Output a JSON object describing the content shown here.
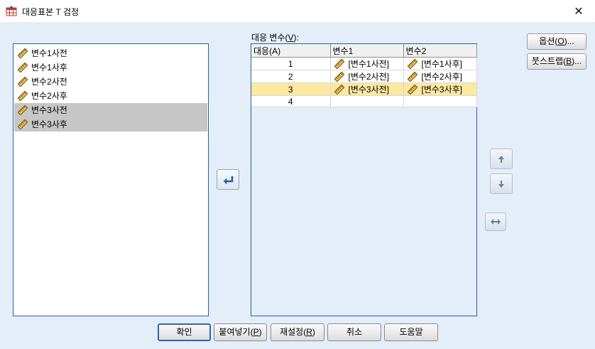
{
  "window": {
    "title": "대응표본 T 검정",
    "close_glyph": "✕"
  },
  "source_list": {
    "items": [
      {
        "label": "변수1사전",
        "selected": false
      },
      {
        "label": "변수1사후",
        "selected": false
      },
      {
        "label": "변수2사전",
        "selected": false
      },
      {
        "label": "변수2사후",
        "selected": false
      },
      {
        "label": "변수3사전",
        "selected": true
      },
      {
        "label": "변수3사후",
        "selected": true
      }
    ]
  },
  "pairs": {
    "label": "대응 변수",
    "mnemonic": "V",
    "headers": [
      "대응(A)",
      "변수1",
      "변수2"
    ],
    "rows": [
      {
        "pair": "1",
        "var1": "[변수1사전]",
        "var2": "[변수1사후]",
        "highlight": false
      },
      {
        "pair": "2",
        "var1": "[변수2사전]",
        "var2": "[변수2사후]",
        "highlight": false
      },
      {
        "pair": "3",
        "var1": "[변수3사전]",
        "var2": "[변수3사후]",
        "highlight": true
      },
      {
        "pair": "4",
        "var1": "",
        "var2": "",
        "highlight": false
      }
    ]
  },
  "side_buttons": {
    "options": {
      "text": "옵션(",
      "mnemonic": "O",
      "suffix": ")..."
    },
    "bootstrap": {
      "text": "붓스트랩(",
      "mnemonic": "B",
      "suffix": ")..."
    }
  },
  "bottom_buttons": {
    "ok": "확인",
    "paste": {
      "text": "붙여넣기(",
      "mnemonic": "P",
      "suffix": ")"
    },
    "reset": {
      "text": "재설정(",
      "mnemonic": "R",
      "suffix": ")"
    },
    "cancel": "취소",
    "help": "도움말"
  },
  "icons": {
    "app": "spss-dialog-icon",
    "variable": "ruler-scale-icon",
    "move": "arrow-left-move-icon",
    "up": "arrow-up-icon",
    "down": "arrow-down-icon",
    "swap": "swap-horizontal-icon"
  },
  "colors": {
    "dialog_bg": "#e3eef9",
    "list_border": "#2a5fa0",
    "selected_row": "#c6c6c6",
    "highlight_row": "#fde8a1",
    "default_button_border": "#2d66b8"
  }
}
